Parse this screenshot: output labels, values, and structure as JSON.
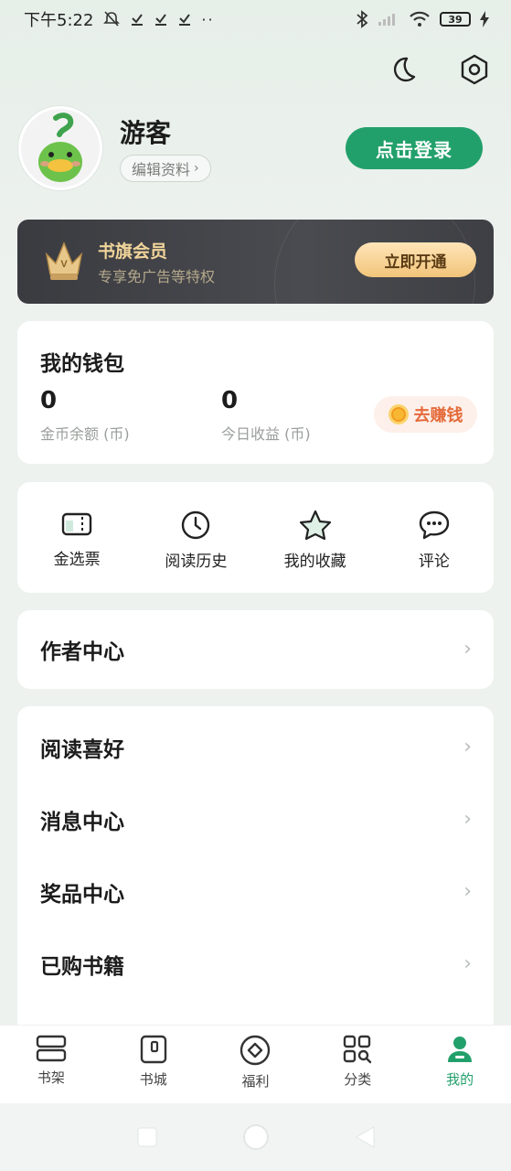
{
  "status_bar": {
    "time": "下午5:22",
    "battery": "39"
  },
  "profile": {
    "username": "游客",
    "edit_label": "编辑资料",
    "login_label": "点击登录"
  },
  "vip": {
    "title": "书旗会员",
    "subtitle": "专享免广告等特权",
    "button": "立即开通"
  },
  "wallet": {
    "title": "我的钱包",
    "coin_balance_value": "0",
    "coin_balance_label": "金币余额 (币)",
    "today_income_value": "0",
    "today_income_label": "今日收益 (币)",
    "earn_button": "去赚钱"
  },
  "quick_actions": [
    {
      "label": "金选票",
      "icon": "ticket-icon"
    },
    {
      "label": "阅读历史",
      "icon": "clock-icon"
    },
    {
      "label": "我的收藏",
      "icon": "star-icon"
    },
    {
      "label": "评论",
      "icon": "comment-icon"
    }
  ],
  "author_center": {
    "label": "作者中心"
  },
  "menu": [
    {
      "label": "阅读喜好"
    },
    {
      "label": "消息中心"
    },
    {
      "label": "奖品中心"
    },
    {
      "label": "已购书籍"
    }
  ],
  "bottom_nav": [
    {
      "label": "书架",
      "icon": "bookshelf-icon"
    },
    {
      "label": "书城",
      "icon": "bookstore-icon"
    },
    {
      "label": "福利",
      "icon": "welfare-icon"
    },
    {
      "label": "分类",
      "icon": "category-icon"
    },
    {
      "label": "我的",
      "icon": "profile-icon",
      "active": true
    }
  ],
  "colors": {
    "accent": "#22a06b",
    "earn": "#e46a3a",
    "vip_gold": "#f0d49a"
  }
}
